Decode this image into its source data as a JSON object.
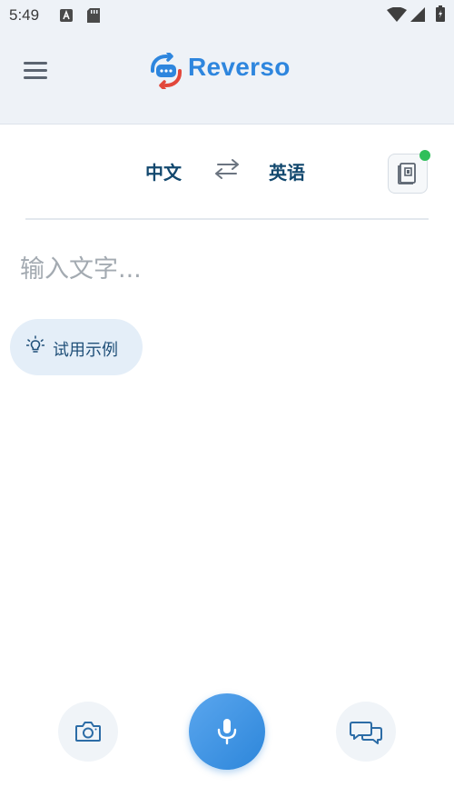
{
  "status_bar": {
    "time": "5:49"
  },
  "header": {
    "logo_text": "Reverso"
  },
  "languages": {
    "source": "中文",
    "target": "英语"
  },
  "input": {
    "placeholder": "输入文字..."
  },
  "example_button": {
    "label": "试用示例"
  },
  "colors": {
    "accent": "#2e86de",
    "lang_text": "#12486e",
    "notification_dot": "#2fbf5a",
    "header_bg": "#eef2f7"
  },
  "icons": {
    "menu": "hamburger-icon",
    "swap": "swap-arrows-icon",
    "book": "phrasebook-icon",
    "bulb": "lightbulb-icon",
    "camera": "camera-icon",
    "mic": "microphone-icon",
    "chat": "conversation-icon"
  }
}
